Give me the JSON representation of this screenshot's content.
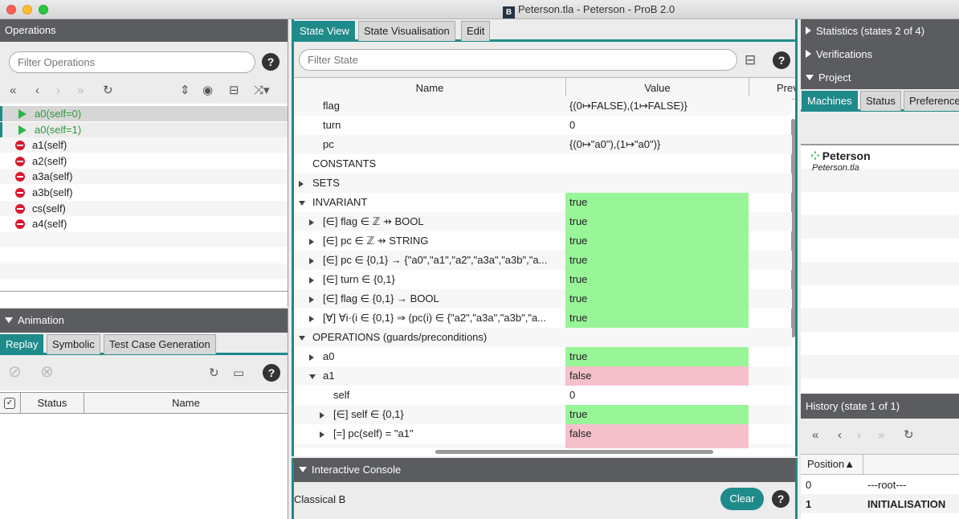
{
  "window": {
    "title": "Peterson.tla - Peterson - ProB 2.0",
    "app_icon": "B"
  },
  "operations": {
    "header": "Operations",
    "filter_placeholder": "Filter Operations",
    "items": [
      {
        "label": "a0(self=0)",
        "enabled": true
      },
      {
        "label": "a0(self=1)",
        "enabled": true
      },
      {
        "label": "a1(self)",
        "enabled": false
      },
      {
        "label": "a2(self)",
        "enabled": false
      },
      {
        "label": "a3a(self)",
        "enabled": false
      },
      {
        "label": "a3b(self)",
        "enabled": false
      },
      {
        "label": "cs(self)",
        "enabled": false
      },
      {
        "label": "a4(self)",
        "enabled": false
      }
    ]
  },
  "animation": {
    "header": "Animation",
    "tabs": [
      "Replay",
      "Symbolic",
      "Test Case Generation"
    ],
    "columns": [
      "Status",
      "Name"
    ]
  },
  "state": {
    "tabs": [
      "State View",
      "State Visualisation",
      "Edit"
    ],
    "filter_placeholder": "Filter State",
    "columns": [
      "Name",
      "Value",
      "Prev"
    ],
    "rows": [
      {
        "name": "flag",
        "value": "{(0↦FALSE),(1↦FALSE)}",
        "indent": 2,
        "toggle": "none",
        "color": ""
      },
      {
        "name": "turn",
        "value": "0",
        "indent": 2,
        "toggle": "none",
        "color": ""
      },
      {
        "name": "pc",
        "value": "{(0↦\"a0\"),(1↦\"a0\")}",
        "indent": 2,
        "toggle": "none",
        "color": ""
      },
      {
        "name": "CONSTANTS",
        "value": "",
        "indent": 1,
        "toggle": "none",
        "color": ""
      },
      {
        "name": "SETS",
        "value": "",
        "indent": 1,
        "toggle": "right",
        "color": ""
      },
      {
        "name": "INVARIANT",
        "value": "true",
        "indent": 1,
        "toggle": "down",
        "color": "green"
      },
      {
        "name": "[∈] flag ∈ ℤ ⇸ BOOL",
        "value": "true",
        "indent": 2,
        "toggle": "right",
        "color": "green"
      },
      {
        "name": "[∈] pc ∈ ℤ ⇸ STRING",
        "value": "true",
        "indent": 2,
        "toggle": "right",
        "color": "green"
      },
      {
        "name": "[∈] pc ∈ {0,1} → {\"a0\",\"a1\",\"a2\",\"a3a\",\"a3b\",\"a...",
        "value": "true",
        "indent": 2,
        "toggle": "right",
        "color": "green"
      },
      {
        "name": "[∈] turn ∈ {0,1}",
        "value": "true",
        "indent": 2,
        "toggle": "right",
        "color": "green"
      },
      {
        "name": "[∈] flag ∈ {0,1} → BOOL",
        "value": "true",
        "indent": 2,
        "toggle": "right",
        "color": "green"
      },
      {
        "name": "[∀] ∀i·(i ∈ {0,1} ⇒ (pc(i) ∈ {\"a2\",\"a3a\",\"a3b\",\"a...",
        "value": "true",
        "indent": 2,
        "toggle": "right",
        "color": "green"
      },
      {
        "name": "OPERATIONS (guards/preconditions)",
        "value": "",
        "indent": 1,
        "toggle": "down",
        "color": ""
      },
      {
        "name": "a0",
        "value": "true",
        "indent": 2,
        "toggle": "right",
        "color": "green"
      },
      {
        "name": "a1",
        "value": "false",
        "indent": 2,
        "toggle": "down",
        "color": "pink"
      },
      {
        "name": "self",
        "value": "0",
        "indent": 3,
        "toggle": "none",
        "color": ""
      },
      {
        "name": "[∈] self ∈ {0,1}",
        "value": "true",
        "indent": 3,
        "toggle": "right",
        "color": "green"
      },
      {
        "name": "[=] pc(self) = \"a1\"",
        "value": "false",
        "indent": 3,
        "toggle": "right",
        "color": "pink"
      }
    ]
  },
  "console": {
    "header": "Interactive Console",
    "language": "Classical B",
    "clear_label": "Clear"
  },
  "right": {
    "statistics": "Statistics (states 2 of 4)",
    "verifications": "Verifications",
    "project": "Project",
    "project_tabs": [
      "Machines",
      "Status",
      "Preferences"
    ],
    "machine_name": "Peterson",
    "machine_file": "Peterson.tla",
    "history_header": "History (state 1 of 1)",
    "history_columns": [
      "Position▲",
      ""
    ],
    "history_rows": [
      {
        "pos": "0",
        "name": "---root---",
        "bold": false
      },
      {
        "pos": "1",
        "name": "INITIALISATION",
        "bold": true
      }
    ]
  },
  "colors": {
    "accent": "#1f8a8a",
    "enabled": "#2fb545",
    "disabled": "#d9182d",
    "true": "#98f598",
    "false": "#f6c0cb"
  }
}
